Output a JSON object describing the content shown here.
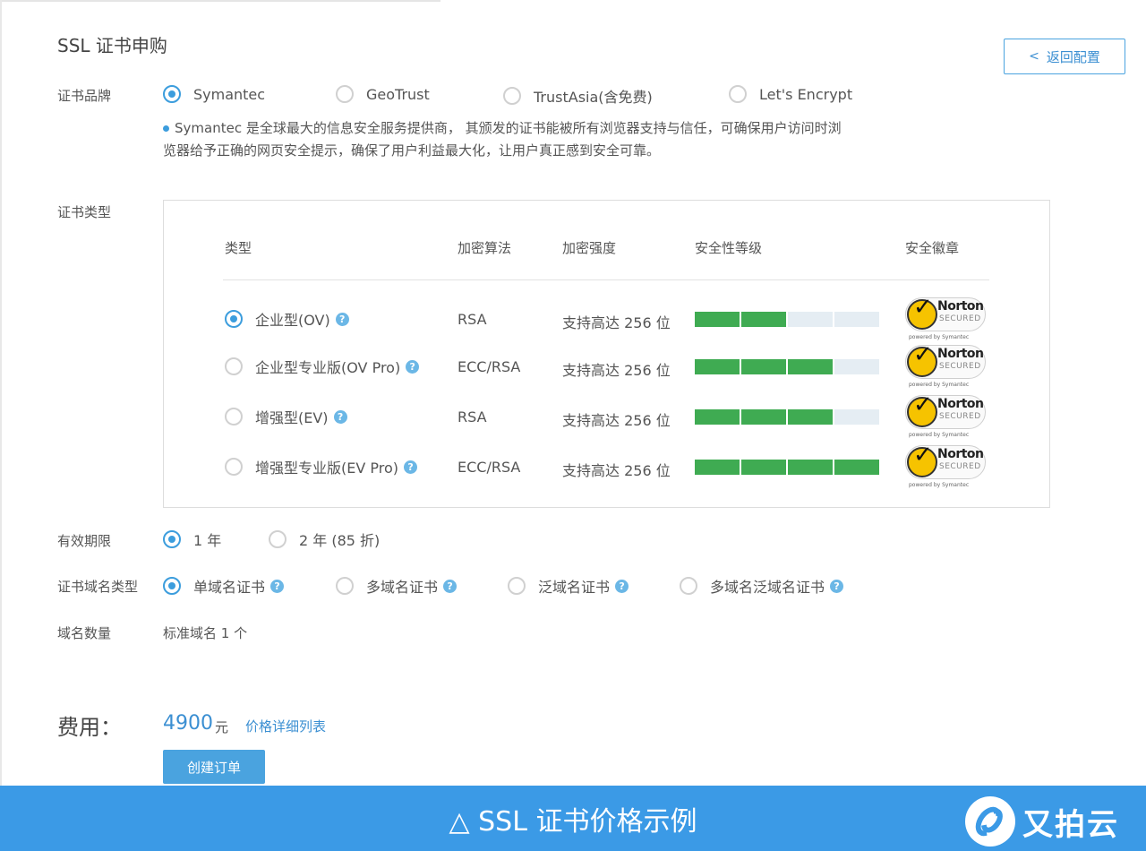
{
  "header": {
    "title": "SSL 证书申购",
    "back_label": "返回配置",
    "back_chevron": "<"
  },
  "brand_row": {
    "label": "证书品牌",
    "options": [
      {
        "label": "Symantec",
        "selected": true
      },
      {
        "label": "GeoTrust",
        "selected": false
      },
      {
        "label": "TrustAsia(含免费)",
        "selected": false
      },
      {
        "label": "Let's Encrypt",
        "selected": false
      }
    ],
    "description_line1": "Symantec 是全球最大的信息安全服务提供商， 其颁发的证书能被所有浏览器支持与信任，可确保用户访问时浏",
    "description_line2": "览器给予正确的网页安全提示，确保了用户利益最大化，让用户真正感到安全可靠。"
  },
  "type_row": {
    "label": "证书类型",
    "columns": [
      "类型",
      "加密算法",
      "加密强度",
      "安全性等级",
      "安全徽章"
    ],
    "rows": [
      {
        "name": "企业型(OV)",
        "algorithm": "RSA",
        "strength": "支持高达 256 位",
        "level": 2,
        "level_max": 4,
        "selected": true
      },
      {
        "name": "企业型专业版(OV Pro)",
        "algorithm": "ECC/RSA",
        "strength": "支持高达 256 位",
        "level": 3,
        "level_max": 4,
        "selected": false
      },
      {
        "name": "增强型(EV)",
        "algorithm": "RSA",
        "strength": "支持高达 256 位",
        "level": 3,
        "level_max": 4,
        "selected": false
      },
      {
        "name": "增强型专业版(EV Pro)",
        "algorithm": "ECC/RSA",
        "strength": "支持高达 256 位",
        "level": 4,
        "level_max": 4,
        "selected": false
      }
    ],
    "badge": {
      "name": "Norton",
      "sub": "SECURED",
      "powered": "powered by Symantec"
    }
  },
  "validity_row": {
    "label": "有效期限",
    "options": [
      {
        "label": "1 年",
        "selected": true
      },
      {
        "label": "2 年 (85 折)",
        "selected": false
      }
    ]
  },
  "domain_type_row": {
    "label": "证书域名类型",
    "options": [
      {
        "label": "单域名证书",
        "selected": true
      },
      {
        "label": "多域名证书",
        "selected": false
      },
      {
        "label": "泛域名证书",
        "selected": false
      },
      {
        "label": "多域名泛域名证书",
        "selected": false
      }
    ]
  },
  "domain_count_row": {
    "label": "域名数量",
    "value": "标准域名 1 个"
  },
  "fee": {
    "label": "费用：",
    "amount": "4900",
    "unit": "元",
    "detail_link": "价格详细列表",
    "create_button": "创建订单"
  },
  "footer": {
    "caption": "△ SSL 证书价格示例",
    "brand_name": "又拍云"
  },
  "colors": {
    "accent": "#3c9ddd",
    "bar_on": "#3fab52",
    "bar_off": "#e5edf3",
    "footer_bg": "#3b9ae6"
  },
  "help_glyph": "?"
}
